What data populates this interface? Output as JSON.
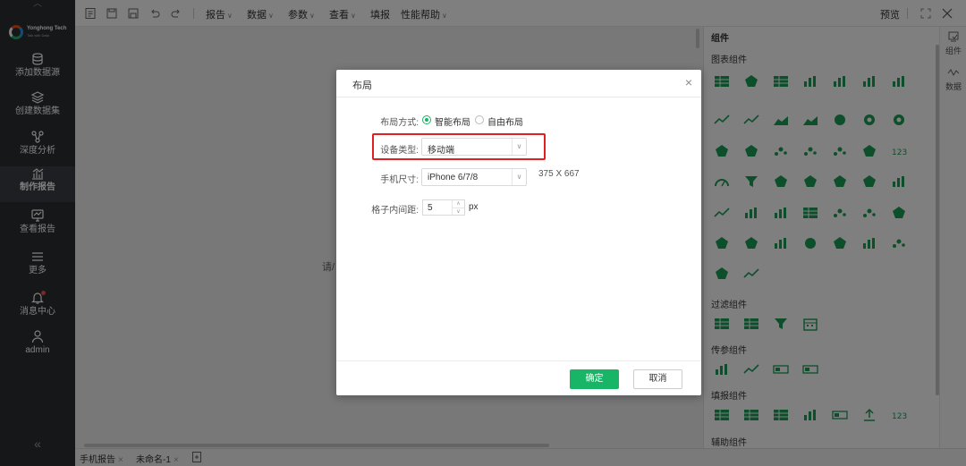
{
  "sidebar": {
    "logo": {
      "name": "Yonghong Tech",
      "tagline": "Talk with Data"
    },
    "items": [
      {
        "label": "添加数据源",
        "icon": "database-icon"
      },
      {
        "label": "创建数据集",
        "icon": "layers-icon"
      },
      {
        "label": "深度分析",
        "icon": "analysis-icon"
      },
      {
        "label": "制作报告",
        "icon": "report-chart-icon"
      },
      {
        "label": "查看报告",
        "icon": "view-report-icon"
      },
      {
        "label": "更多",
        "icon": "menu-icon"
      },
      {
        "label": "消息中心",
        "icon": "bell-icon"
      },
      {
        "label": "admin",
        "icon": "user-icon"
      }
    ],
    "active": "制作报告",
    "collapse": "«"
  },
  "toolbar": {
    "menus": [
      "报告",
      "数据",
      "参数",
      "查看",
      "填报",
      "性能帮助"
    ],
    "right": {
      "preview": "预览"
    }
  },
  "canvas": {
    "hint": "请/"
  },
  "tabs": [
    {
      "label": "手机报告"
    },
    {
      "label": "未命名-1"
    }
  ],
  "rpanel": {
    "title": "组件",
    "sections": [
      "图表组件",
      "过滤组件",
      "传参组件",
      "填报组件",
      "辅助组件"
    ]
  },
  "rrail": {
    "items": [
      "组件",
      "数据"
    ]
  },
  "dialog": {
    "title": "布局",
    "close": "×",
    "layout_label": "布局方式:",
    "layout_options": [
      "智能布局",
      "自由布局"
    ],
    "layout_selected": "智能布局",
    "device_label": "设备类型:",
    "device_value": "移动端",
    "size_label": "手机尺寸:",
    "size_value": "iPhone 6/7/8",
    "size_dims": "375 X 667",
    "padding_label": "格子内间距:",
    "padding_value": "5",
    "padding_unit": "px",
    "ok": "确定",
    "cancel": "取消"
  },
  "colors": {
    "accent": "#18b566",
    "sidebar": "#2c2f33",
    "highlight": "#e02020",
    "component_icons": "#1a9c56"
  }
}
